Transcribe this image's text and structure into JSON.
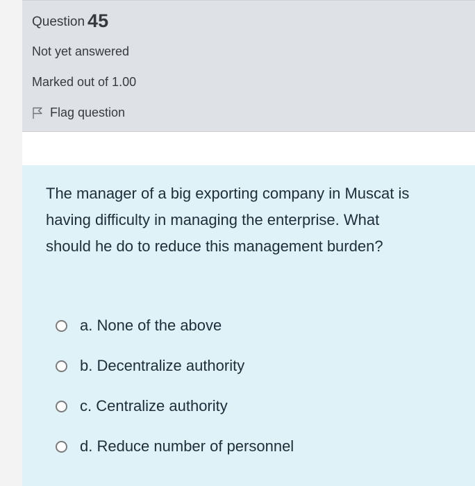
{
  "info": {
    "question_label": "Question",
    "question_number": "45",
    "state": "Not yet answered",
    "grade": "Marked out of 1.00",
    "flag_label": "Flag question",
    "flag_icon": "flag-icon"
  },
  "question": {
    "text": "The manager of a big exporting company in Muscat is having difficulty in managing the enterprise. What should he do to reduce this management burden?",
    "options": [
      {
        "label": "a. None of the above",
        "selected": false
      },
      {
        "label": "b. Decentralize authority",
        "selected": false
      },
      {
        "label": "c. Centralize authority",
        "selected": false
      },
      {
        "label": "d. Reduce number of personnel",
        "selected": false
      }
    ]
  },
  "colors": {
    "info_background": "#dee2e6",
    "content_background": "#def2f8",
    "text": "#1f2d3a"
  }
}
